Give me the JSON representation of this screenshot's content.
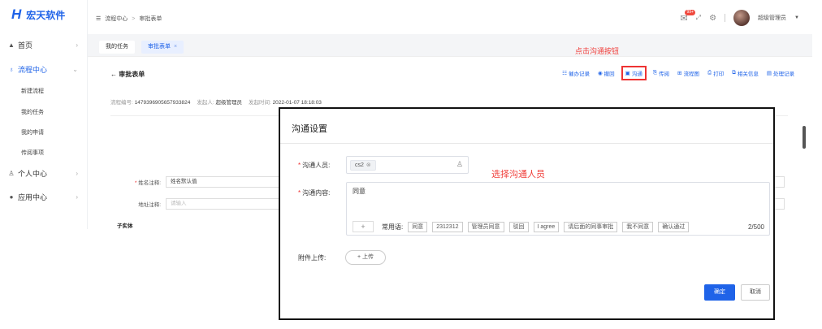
{
  "brand": {
    "name": "宏天软件",
    "logo_mark": "H"
  },
  "sidebar": {
    "items": [
      {
        "label": "首页",
        "icon": "home-icon"
      },
      {
        "label": "流程中心",
        "icon": "flow-icon"
      },
      {
        "label": "个人中心",
        "icon": "user-icon"
      },
      {
        "label": "应用中心",
        "icon": "app-icon"
      }
    ],
    "sub_items": [
      "新建流程",
      "我的任务",
      "我的申请",
      "传阅事项"
    ]
  },
  "header": {
    "breadcrumb": [
      "流程中心",
      "审批表单"
    ],
    "notification_count": "99+",
    "user_name": "超级管理员"
  },
  "tabs": [
    {
      "label": "我的任务"
    },
    {
      "label": "审批表单"
    }
  ],
  "form_page": {
    "back_title": "审批表单",
    "toolbar": [
      "催办记录",
      "撤回",
      "沟通",
      "传阅",
      "流程图",
      "打印",
      "相关信息",
      "处理记录"
    ],
    "annotation_top": "点击沟通按钮",
    "meta": {
      "no_label": "流程编号:",
      "no_value": "1479396905657933824",
      "initiator_label": "发起人:",
      "initiator_value": "超级管理员",
      "time_label": "发起时间:",
      "time_value": "2022-01-07 18:18:03"
    },
    "fields": [
      {
        "label": "姓名注释:",
        "value": "姓名默认值"
      },
      {
        "label": "地址注释:",
        "placeholder": "请输入"
      }
    ],
    "sub_entity": "子实体"
  },
  "modal": {
    "title": "沟通设置",
    "person_label": "沟通人员:",
    "person_chip": "cs2",
    "annotation_select": "选择沟通人员",
    "content_label": "沟通内容:",
    "content_value": "同意",
    "add_symbol": "+",
    "common_label": "常用语:",
    "phrases": [
      "同意",
      "2312312",
      "管理员同意",
      "驳回",
      "I agree",
      "请后面的同事审批",
      "我不同意",
      "确认通过"
    ],
    "count": "2/500",
    "attachment_label": "附件上传:",
    "upload_label": "+ 上传",
    "confirm": "确定",
    "cancel": "取消"
  },
  "colors": {
    "accent": "#1f63e8",
    "annotation": "#f0403c",
    "badge": "#f0493e"
  }
}
